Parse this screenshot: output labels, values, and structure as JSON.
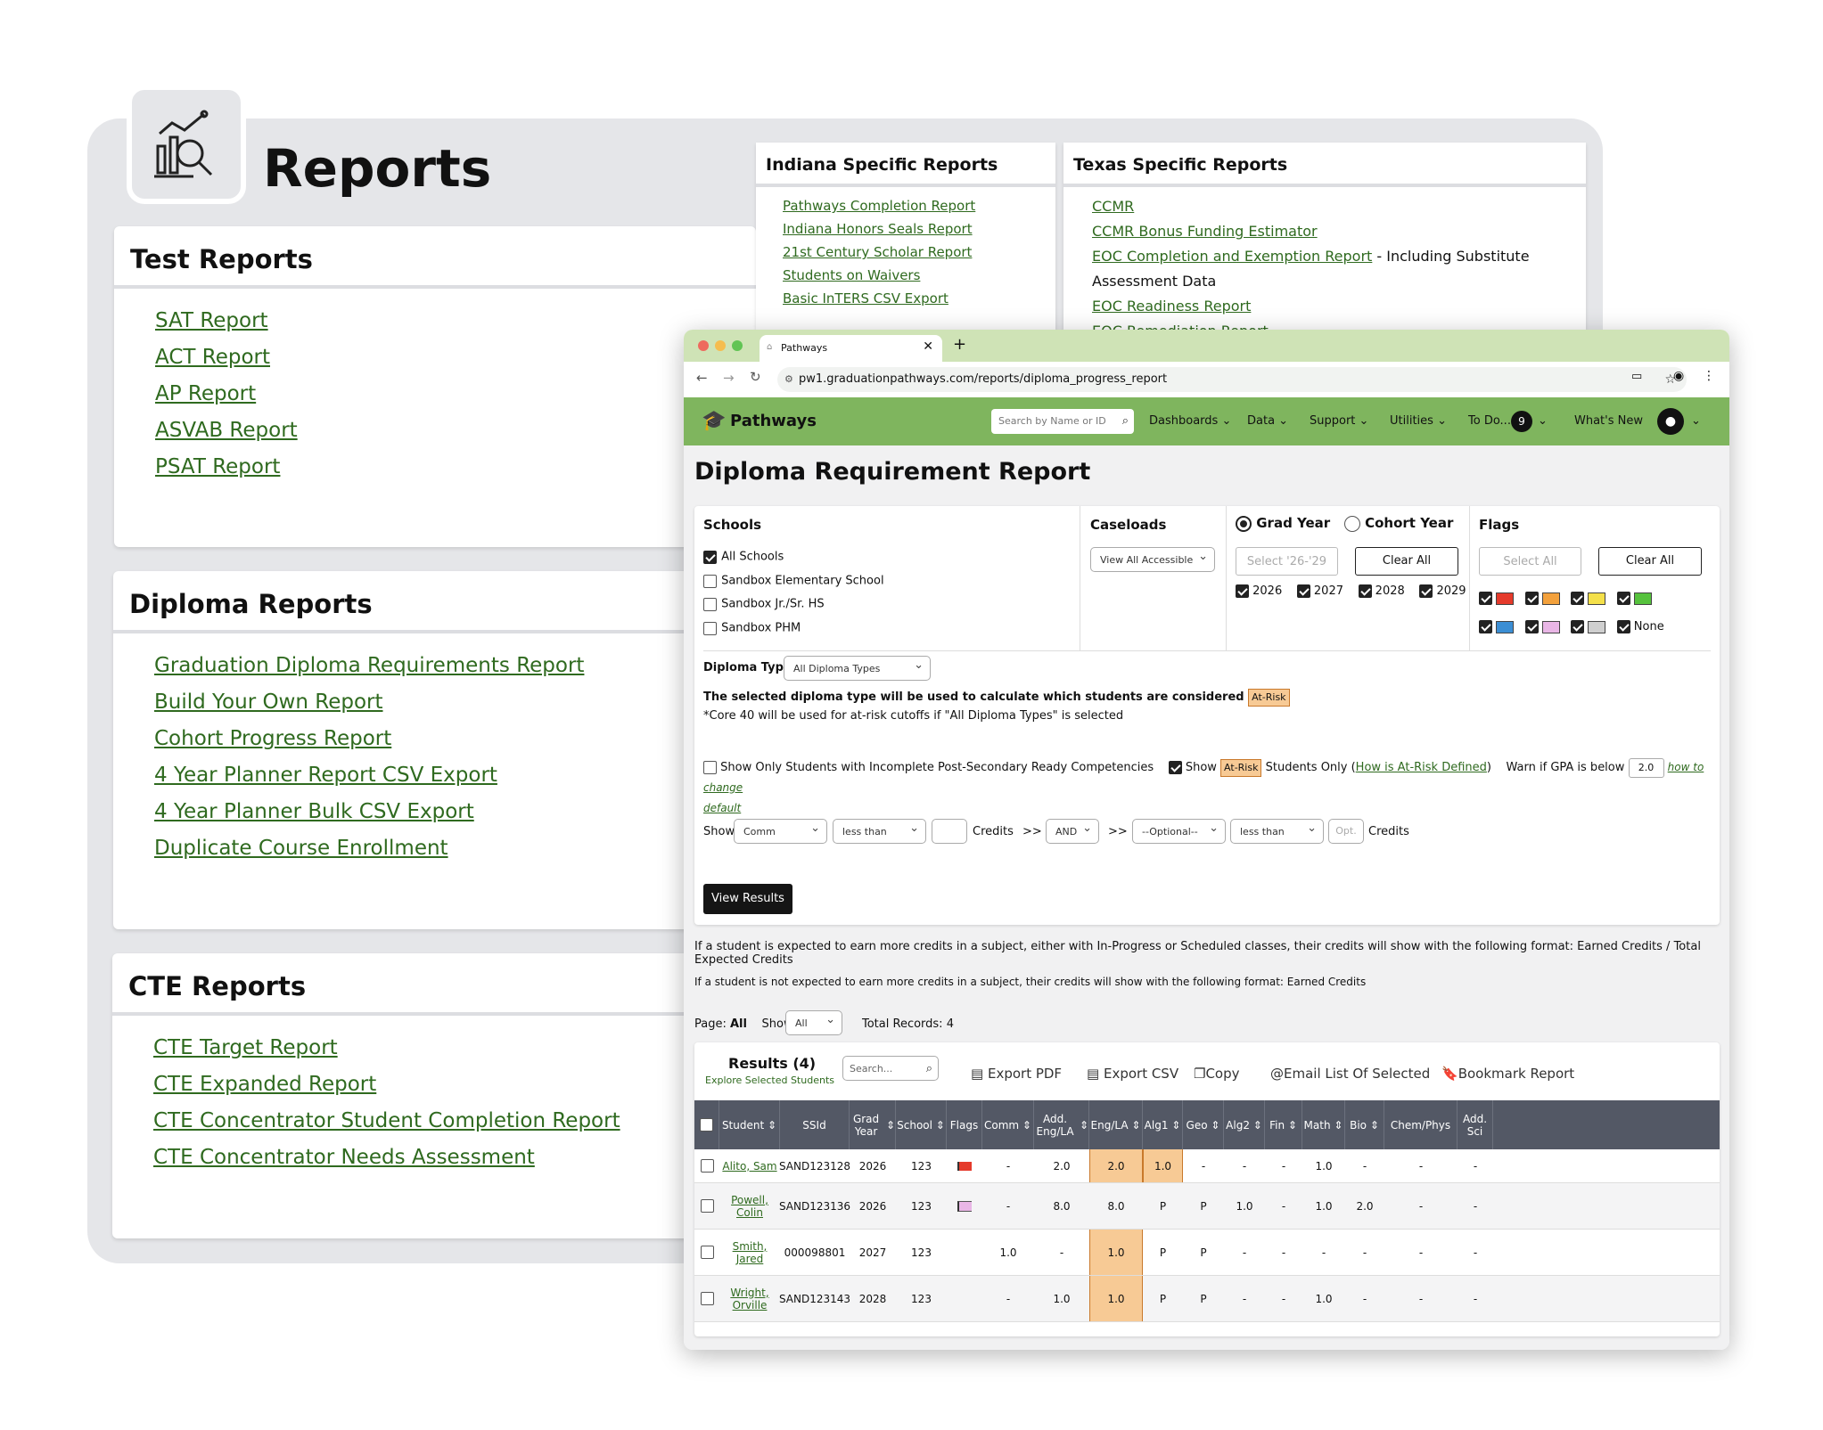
{
  "reports_title": "Reports",
  "test_reports": {
    "title": "Test Reports",
    "links": [
      "SAT Report",
      "ACT Report",
      "AP Report",
      "ASVAB Report",
      "PSAT Report"
    ]
  },
  "diploma_reports": {
    "title": "Diploma Reports",
    "links": [
      "Graduation Diploma Requirements Report",
      "Build Your Own Report",
      "Cohort Progress Report",
      "4 Year Planner Report CSV Export",
      "4 Year Planner Bulk CSV Export",
      "Duplicate Course Enrollment"
    ]
  },
  "cte_reports": {
    "title": "CTE Reports",
    "links": [
      "CTE Target Report",
      "CTE Expanded Report",
      "CTE Concentrator Student Completion Report",
      "CTE Concentrator Needs Assessment"
    ]
  },
  "indiana": {
    "title": "Indiana Specific Reports",
    "links": [
      "Pathways Completion Report",
      "Indiana Honors Seals Report",
      "21st Century Scholar Report",
      "Students on Waivers",
      "Basic InTERS CSV Export"
    ]
  },
  "texas": {
    "title": "Texas Specific Reports",
    "links": [
      "CCMR",
      "CCMR Bonus Funding Estimator",
      "EOC Completion and Exemption Report",
      "EOC Readiness Report",
      "EOC Remediation Report"
    ],
    "eoc_suffix": " - Including Substitute Assessment Data"
  },
  "browser": {
    "tab_title": "Pathways",
    "url": "pw1.graduationpathways.com/reports/diploma_progress_report"
  },
  "nav": {
    "brand": "Pathways",
    "search_placeholder": "Search by Name or ID",
    "items": [
      "Dashboards",
      "Data",
      "Support",
      "Utilities",
      "To Do..."
    ],
    "todo_count": "9",
    "whats_new": "What's New"
  },
  "page_title": "Diploma Requirement Report",
  "schools": {
    "title": "Schools",
    "options": [
      {
        "label": "All Schools",
        "checked": true
      },
      {
        "label": "Sandbox Elementary School",
        "checked": false
      },
      {
        "label": "Sandbox Jr./Sr. HS",
        "checked": false
      },
      {
        "label": "Sandbox PHM",
        "checked": false
      }
    ]
  },
  "caseloads": {
    "title": "Caseloads",
    "selected": "View All Accessible"
  },
  "year": {
    "grad_label": "Grad Year",
    "cohort_label": "Cohort Year",
    "select_placeholder": "Select '26-'29",
    "clear_all": "Clear All",
    "years": [
      "2026",
      "2027",
      "2028",
      "2029"
    ]
  },
  "flags": {
    "title": "Flags",
    "select_all": "Select All",
    "clear_all": "Clear All",
    "none_label": "None",
    "colors": [
      "#e53a2b",
      "#f3a13c",
      "#f4e04a",
      "#56c23d",
      "#3b8ed4",
      "#e9b6e6",
      "#cfcfcf"
    ]
  },
  "diploma_type": {
    "label": "Diploma Type:",
    "selected": "All Diploma Types",
    "note1": "The selected diploma type will be used to calculate which students are considered",
    "at_risk": "At-Risk",
    "note2": "*Core 40 will be used for at-risk cutoffs if \"All Diploma Types\" is selected"
  },
  "options_row": {
    "incomplete_label": "Show Only Students with Incomplete Post-Secondary Ready Competencies",
    "show_label": "Show",
    "students_only": "Students Only (",
    "how_defined": "How is At-Risk Defined",
    "close_paren": ")",
    "warn_gpa": "Warn if GPA is below",
    "gpa_value": "2.0",
    "how_to_change": "how to change",
    "default": "default"
  },
  "credits_row": {
    "show": "Show",
    "subject": "Comm",
    "op1": "less than",
    "credits": "Credits",
    "arrows": ">>",
    "logic": "AND",
    "optional": "--Optional--",
    "op2": "less than",
    "opt_placeholder": "Opt."
  },
  "view_results": "View Results",
  "info1": "If a student is expected to earn more credits in a subject, either with In-Progress or Scheduled classes, their credits will show with the following format: Earned Credits / Total Expected Credits",
  "info2": "If a student is not expected to earn more credits in a subject, their credits will show with the following format: Earned Credits",
  "paging": {
    "page_label": "Page:",
    "page_value": "All",
    "show_label": "Show:",
    "show_value": "All",
    "total": "Total Records: 4"
  },
  "results": {
    "title": "Results (4)",
    "subtitle": "Explore Selected Students",
    "search_placeholder": "Search...",
    "tools": [
      "Export PDF",
      "Export CSV",
      "Copy",
      "Email List Of Selected",
      "Bookmark Report"
    ],
    "columns": [
      "Student",
      "SSId",
      "Grad Year",
      "School",
      "Flags",
      "Comm",
      "Add. Eng/LA",
      "Eng/LA",
      "Alg1",
      "Geo",
      "Alg2",
      "Fin",
      "Math",
      "Bio",
      "Chem/Phys",
      "Add. Sci"
    ],
    "rows": [
      {
        "student": "Alito, Sam",
        "ssid": "SAND123128",
        "grad": "2026",
        "school": "123",
        "flag": "red",
        "comm": "-",
        "add_eng": "2.0",
        "eng": "2.0",
        "alg1": "1.0",
        "geo": "-",
        "alg2": "-",
        "fin": "-",
        "math": "1.0",
        "bio": "-",
        "chem": "-",
        "add_sci": "-"
      },
      {
        "student": "Powell, Colin",
        "ssid": "SAND123136",
        "grad": "2026",
        "school": "123",
        "flag": "pink",
        "comm": "-",
        "add_eng": "8.0",
        "eng": "8.0",
        "alg1": "P",
        "geo": "P",
        "alg2": "1.0",
        "fin": "-",
        "math": "1.0",
        "bio": "2.0",
        "chem": "-",
        "add_sci": "-"
      },
      {
        "student": "Smith, Jared",
        "ssid": "000098801",
        "grad": "2027",
        "school": "123",
        "flag": "",
        "comm": "1.0",
        "add_eng": "-",
        "eng": "1.0",
        "alg1": "P",
        "geo": "P",
        "alg2": "-",
        "fin": "-",
        "math": "-",
        "bio": "-",
        "chem": "-",
        "add_sci": "-"
      },
      {
        "student": "Wright, Orville",
        "ssid": "SAND123143",
        "grad": "2028",
        "school": "123",
        "flag": "",
        "comm": "-",
        "add_eng": "1.0",
        "eng": "1.0",
        "alg1": "P",
        "geo": "P",
        "alg2": "-",
        "fin": "-",
        "math": "1.0",
        "bio": "-",
        "chem": "-",
        "add_sci": "-"
      }
    ]
  }
}
